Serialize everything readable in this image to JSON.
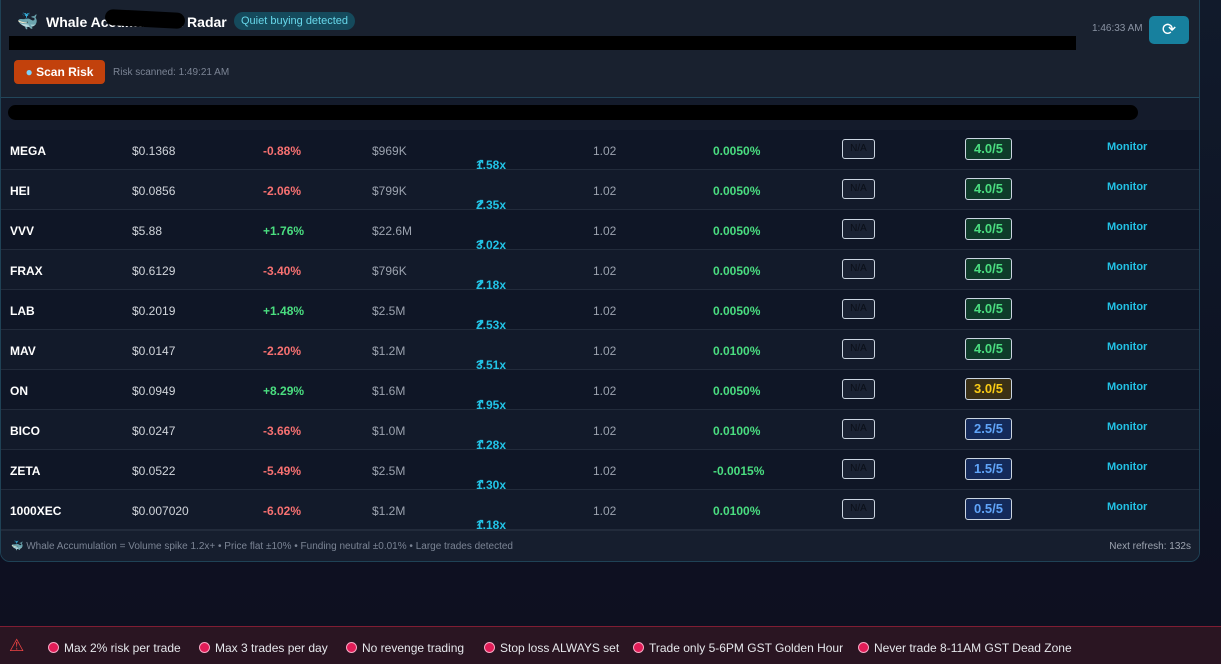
{
  "header": {
    "title": "Whale Accumulation Radar",
    "badge": "Quiet buying detected",
    "time": "1:46:33 AM",
    "scan_label": "Scan Risk",
    "risk_scanned": "Risk scanned: 1:49:21 AM"
  },
  "rows": [
    {
      "symbol": "MEGA",
      "price": "$0.1368",
      "change": "-0.88%",
      "volume": "$969K",
      "spike": "1.58x",
      "ratio": "1.02",
      "funding": "0.0050%",
      "risk": "N/A",
      "score": "4.0/5",
      "action": "Monitor"
    },
    {
      "symbol": "HEI",
      "price": "$0.0856",
      "change": "-2.06%",
      "volume": "$799K",
      "spike": "2.35x",
      "ratio": "1.02",
      "funding": "0.0050%",
      "risk": "N/A",
      "score": "4.0/5",
      "action": "Monitor"
    },
    {
      "symbol": "VVV",
      "price": "$5.88",
      "change": "+1.76%",
      "volume": "$22.6M",
      "spike": "3.02x",
      "ratio": "1.02",
      "funding": "0.0050%",
      "risk": "N/A",
      "score": "4.0/5",
      "action": "Monitor"
    },
    {
      "symbol": "FRAX",
      "price": "$0.6129",
      "change": "-3.40%",
      "volume": "$796K",
      "spike": "2.18x",
      "ratio": "1.02",
      "funding": "0.0050%",
      "risk": "N/A",
      "score": "4.0/5",
      "action": "Monitor"
    },
    {
      "symbol": "LAB",
      "price": "$0.2019",
      "change": "+1.48%",
      "volume": "$2.5M",
      "spike": "2.53x",
      "ratio": "1.02",
      "funding": "0.0050%",
      "risk": "N/A",
      "score": "4.0/5",
      "action": "Monitor"
    },
    {
      "symbol": "MAV",
      "price": "$0.0147",
      "change": "-2.20%",
      "volume": "$1.2M",
      "spike": "3.51x",
      "ratio": "1.02",
      "funding": "0.0100%",
      "risk": "N/A",
      "score": "4.0/5",
      "action": "Monitor"
    },
    {
      "symbol": "ON",
      "price": "$0.0949",
      "change": "+8.29%",
      "volume": "$1.6M",
      "spike": "1.95x",
      "ratio": "1.02",
      "funding": "0.0050%",
      "risk": "N/A",
      "score": "3.0/5",
      "action": "Monitor"
    },
    {
      "symbol": "BICO",
      "price": "$0.0247",
      "change": "-3.66%",
      "volume": "$1.0M",
      "spike": "1.28x",
      "ratio": "1.02",
      "funding": "0.0100%",
      "risk": "N/A",
      "score": "2.5/5",
      "action": "Monitor"
    },
    {
      "symbol": "ZETA",
      "price": "$0.0522",
      "change": "-5.49%",
      "volume": "$2.5M",
      "spike": "1.30x",
      "ratio": "1.02",
      "funding": "-0.0015%",
      "risk": "N/A",
      "score": "1.5/5",
      "action": "Monitor"
    },
    {
      "symbol": "1000XEC",
      "price": "$0.007020",
      "change": "-6.02%",
      "volume": "$1.2M",
      "spike": "1.18x",
      "ratio": "1.02",
      "funding": "0.0100%",
      "risk": "N/A",
      "score": "0.5/5",
      "action": "Monitor"
    }
  ],
  "footer": {
    "legend": "Whale Accumulation = Volume spike 1.2x+ • Price flat ±10% • Funding neutral ±0.01% • Large trades detected",
    "next_refresh": "Next refresh: 132s"
  },
  "rules": [
    "Max 2% risk per trade",
    "Max 3 trades per day",
    "No revenge trading",
    "Stop loss ALWAYS set",
    "Trade only 5-6PM GST Golden Hour",
    "Never trade 8-11AM GST Dead Zone"
  ],
  "colors": {
    "high": "#4ade80",
    "mid": "#facc15",
    "low": "#60a5fa"
  }
}
